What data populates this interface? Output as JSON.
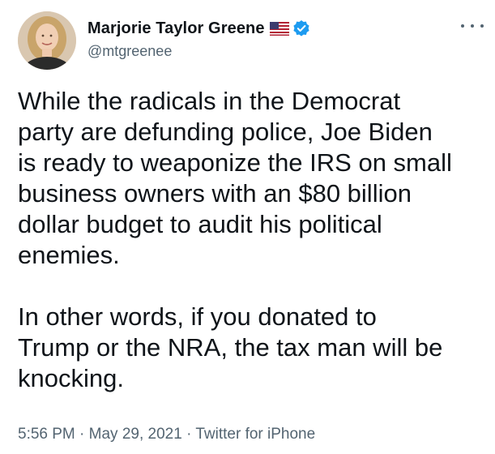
{
  "author": {
    "display_name": "Marjorie Taylor Greene",
    "handle": "@mtgreenee",
    "flag_icon": "us-flag-icon",
    "verified_icon": "verified-badge-icon"
  },
  "menu": {
    "more_icon": "more-options-icon"
  },
  "tweet": {
    "paragraphs": [
      "While the radicals in the Democrat\nparty are defunding police, Joe Biden\nis ready to weaponize the IRS on small\nbusiness owners with an $80 billion\ndollar budget to audit his political\nenemies.",
      "In other words, if you donated to\nTrump or the NRA, the tax man will be\nknocking."
    ]
  },
  "meta": {
    "time": "5:56 PM",
    "separator": " · ",
    "date": "May 29, 2021",
    "source": "Twitter for iPhone"
  },
  "colors": {
    "text": "#0f1419",
    "secondary": "#536471",
    "verified": "#1d9bf0"
  }
}
